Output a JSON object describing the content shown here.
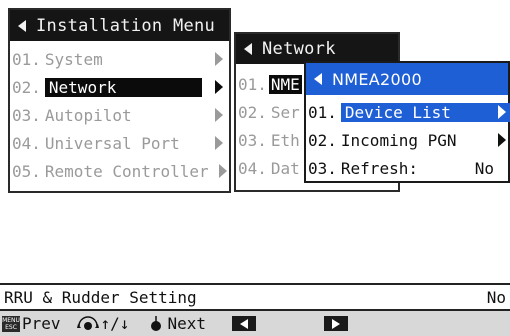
{
  "installation_menu": {
    "title": "Installation Menu",
    "items": [
      {
        "num": "01.",
        "label": "System",
        "has_submenu": true
      },
      {
        "num": "02.",
        "label": "Network",
        "has_submenu": true,
        "selected": true
      },
      {
        "num": "03.",
        "label": "Autopilot",
        "has_submenu": true
      },
      {
        "num": "04.",
        "label": "Universal Port",
        "has_submenu": true
      },
      {
        "num": "05.",
        "label": "Remote Controller",
        "has_submenu": true
      }
    ]
  },
  "network_menu": {
    "title": "Network",
    "items": [
      {
        "num": "01.",
        "label": "NME",
        "selected": true
      },
      {
        "num": "02.",
        "label": "Ser"
      },
      {
        "num": "03.",
        "label": "Eth"
      },
      {
        "num": "04.",
        "label": "Dat"
      }
    ]
  },
  "nmea2000_menu": {
    "title": "NMEA2000",
    "items": [
      {
        "num": "01.",
        "label": "Device List",
        "has_submenu": true,
        "selected": true
      },
      {
        "num": "02.",
        "label": "Incoming PGN",
        "has_submenu": true
      },
      {
        "num": "03.",
        "label": "Refresh:",
        "value": "No"
      }
    ]
  },
  "status_line": {
    "label": "RRU & Rudder Setting",
    "value": "No"
  },
  "bottom_bar": {
    "menu_key_top": "MENU",
    "menu_key_bottom": "ESC",
    "prev_label": "Prev",
    "updown_label": "↑/↓",
    "next_label": "Next"
  },
  "colors": {
    "accent": "#1f5fd6",
    "title_bar": "#151515",
    "selected_bg": "#0b0b0b",
    "inactive_text": "#9a9a9a",
    "bottom_bar_bg": "#d8d8d8"
  },
  "icons": [
    "back-triangle-icon",
    "submenu-arrow-icon",
    "menu-esc-key-icon",
    "scroll-knob-icon",
    "knob-push-icon",
    "cursor-left-icon",
    "cursor-right-icon"
  ]
}
